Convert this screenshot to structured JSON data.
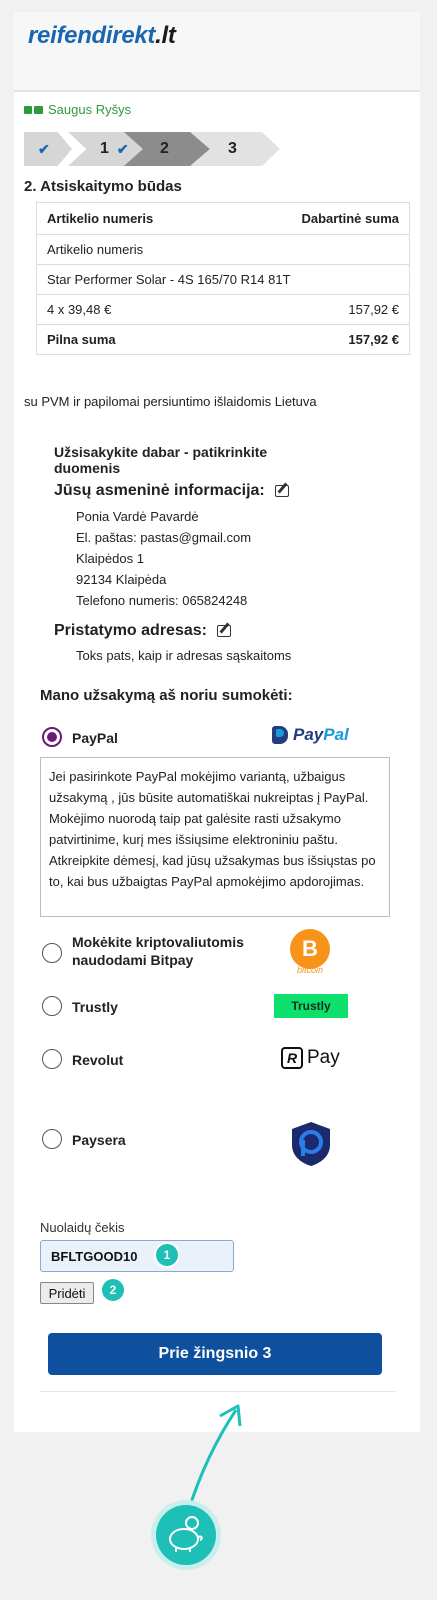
{
  "header": {
    "logo_main": "reifendirekt",
    "logo_tld": ".lt"
  },
  "secure": {
    "label": "Saugus Ryšys"
  },
  "steps": [
    {
      "label": "",
      "state": "done"
    },
    {
      "label": "1",
      "state": "done"
    },
    {
      "label": "2",
      "state": "active"
    },
    {
      "label": "3",
      "state": "upcoming"
    }
  ],
  "section_title": "2. Atsiskaitymo būdas",
  "order_table": {
    "col_article": "Artikelio numeris",
    "col_amount": "Dabartinė suma",
    "row_article_label": "Artikelio numeris",
    "product": "Star Performer Solar - 4S 165/70 R14 81T",
    "qty_price": "4  x  39,48 €",
    "line_total": "157,92 €",
    "total_label": "Pilna suma",
    "total_value": "157,92 €"
  },
  "vat_note": "su PVM ir papilomai persiuntimo išlaidomis Lietuva",
  "confirm": {
    "title": "Užsisakykite dabar - patikrinkite duomenis",
    "personal_head": "Jūsų asmeninė informacija:",
    "name": "Ponia Vardė Pavardė",
    "email": "El. paštas: pastas@gmail.com",
    "street": "Klaipėdos 1",
    "city": "92134 Klaipėda",
    "phone": "Telefono numeris: 065824248",
    "delivery_head": "Pristatymo adresas:",
    "delivery_line": "Toks pats, kaip ir adresas sąskaitoms"
  },
  "payment": {
    "title": "Mano užsakymą aš noriu sumokėti:",
    "paypal_label": "PayPal",
    "paypal_logo_a": "Pay",
    "paypal_logo_b": "Pal",
    "paypal_desc": "Jei pasirinkote PayPal mokėjimo variantą, užbaigus užsakymą , jūs būsite automatiškai nukreiptas į PayPal. Mokėjimo nuorodą taip pat galėsite rasti užsakymo patvirtinime, kurį mes išsiųsime elektroniniu paštu. Atkreipkite dėmesį, kad jūsų užsakymas bus išsiųstas po to, kai bus užbaigtas PayPal apmokėjimo apdorojimas.",
    "bitpay_label": "Mokėkite kriptovaliutomis naudodami Bitpay",
    "bitcoin_symbol": "B",
    "bitcoin_word": "bitcoin",
    "trustly_label": "Trustly",
    "trustly_logo": "Trustly",
    "revolut_label": "Revolut",
    "revolut_box": "R",
    "revolut_pay": "Pay",
    "paysera_label": "Paysera",
    "selected": "PayPal"
  },
  "coupon": {
    "label": "Nuolaidų čekis",
    "value": "BFLTGOOD10",
    "add_label": "Pridėti",
    "badge1": "1",
    "badge2": "2"
  },
  "next_button": "Prie žingsnio 3",
  "colors": {
    "brand": "#1b66b1",
    "primary_button": "#0e4f9e",
    "accent": "#1dbfb6",
    "radio_selected": "#6a1b7a"
  }
}
